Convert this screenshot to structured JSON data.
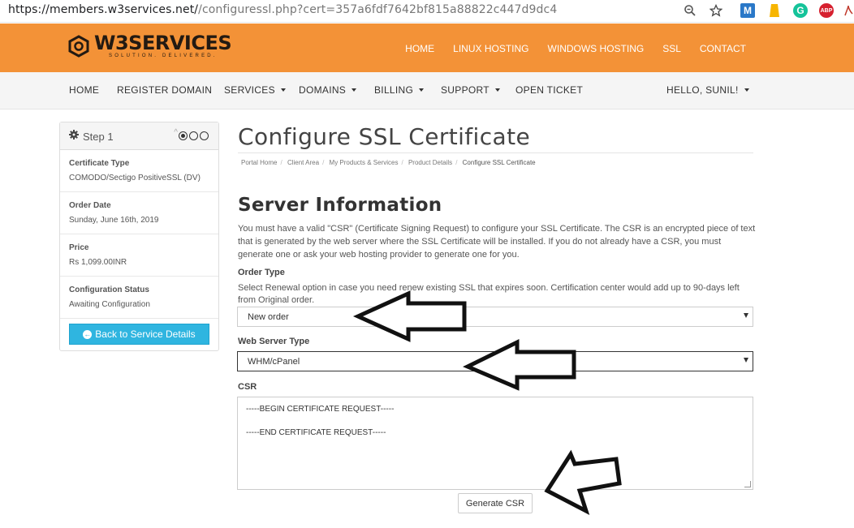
{
  "browser": {
    "url_host": "https://members.w3services.net/",
    "url_path": "/configuressl.php?cert=357a6fdf7642bf815a88822c447d9dc4",
    "ext_m_label": "M",
    "ext_g_label": "G",
    "ext_abp_label": "ABP"
  },
  "header": {
    "logo_text": "W3SERVICES",
    "logo_tagline": "SOLUTION. DELIVERED.",
    "nav": [
      "HOME",
      "LINUX HOSTING",
      "WINDOWS HOSTING",
      "SSL",
      "CONTACT"
    ]
  },
  "mainnav": {
    "home": "HOME",
    "register_domain": "REGISTER DOMAIN",
    "services": "SERVICES",
    "domains": "DOMAINS",
    "billing": "BILLING",
    "support": "SUPPORT",
    "open_ticket": "OPEN TICKET",
    "user": "HELLO, SUNIL!"
  },
  "sidebar": {
    "step": "Step 1",
    "items": [
      {
        "label": "Certificate Type",
        "value": "COMODO/Sectigo PositiveSSL (DV)"
      },
      {
        "label": "Order Date",
        "value": "Sunday, June 16th, 2019"
      },
      {
        "label": "Price",
        "value": "Rs 1,099.00INR"
      },
      {
        "label": "Configuration Status",
        "value": "Awaiting Configuration"
      }
    ],
    "back_button": "Back to Service Details"
  },
  "main": {
    "title": "Configure SSL Certificate",
    "breadcrumbs": [
      "Portal Home",
      "Client Area",
      "My Products & Services",
      "Product Details",
      "Configure SSL Certificate"
    ],
    "section_title": "Server Information",
    "intro": "You must have a valid \"CSR\" (Certificate Signing Request) to configure your SSL Certificate. The CSR is an encrypted piece of text that is generated by the web server where the SSL Certificate will be installed. If you do not already have a CSR, you must generate one or ask your web hosting provider to generate one for you.",
    "order_type_label": "Order Type",
    "order_type_help": "Select Renewal option in case you need renew existing SSL that expires soon. Certification center would add up to 90-days left from Original order.",
    "order_type_value": "New order",
    "web_server_label": "Web Server Type",
    "web_server_value": "WHM/cPanel",
    "csr_label": "CSR",
    "csr_begin": "-----BEGIN CERTIFICATE REQUEST-----",
    "csr_end": "-----END CERTIFICATE REQUEST-----",
    "generate_button": "Generate CSR"
  },
  "colors": {
    "header_orange": "#f39237",
    "button_blue": "#2fb5e0"
  }
}
